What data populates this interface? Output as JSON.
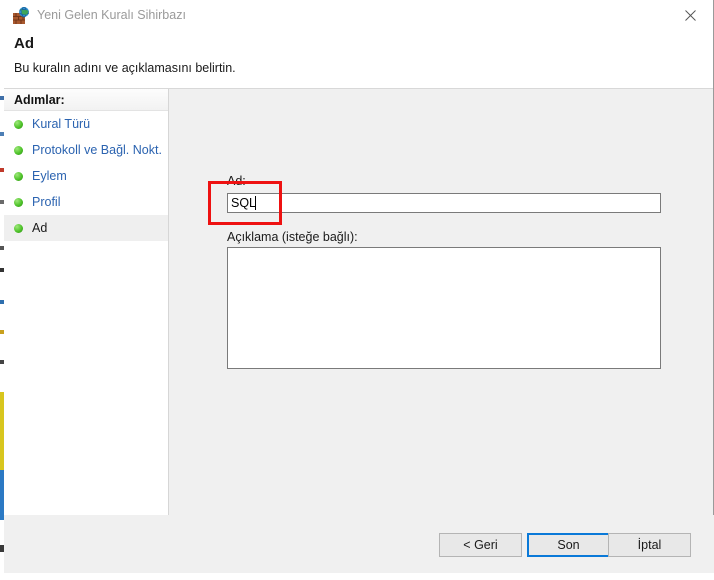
{
  "window": {
    "title": "Yeni Gelen Kuralı Sihirbazı",
    "icon": "firewall-globe-icon",
    "close_label": "✕"
  },
  "header": {
    "title": "Ad",
    "subtitle": "Bu kuralın adını ve açıklamasını belirtin."
  },
  "sidebar": {
    "header": "Adımlar:",
    "items": [
      {
        "label": "Kural Türü",
        "state": "done"
      },
      {
        "label": "Protokoll ve Bağl. Nokt.",
        "state": "done"
      },
      {
        "label": "Eylem",
        "state": "done"
      },
      {
        "label": "Profil",
        "state": "done"
      },
      {
        "label": "Ad",
        "state": "current"
      }
    ]
  },
  "form": {
    "name_label": "Ad:",
    "name_value": "SQL",
    "name_placeholder": "",
    "description_label": "Açıklama (isteğe bağlı):",
    "description_value": "",
    "description_placeholder": ""
  },
  "footer": {
    "back_label": "< Geri",
    "finish_label": "Son",
    "cancel_label": "İptal"
  },
  "colors": {
    "accent_focus": "#0a79d8",
    "highlight": "#ee1111",
    "link": "#2b63b0",
    "bullet_green": "#4fc32a",
    "dialog_bg": "#f0f0f0"
  }
}
